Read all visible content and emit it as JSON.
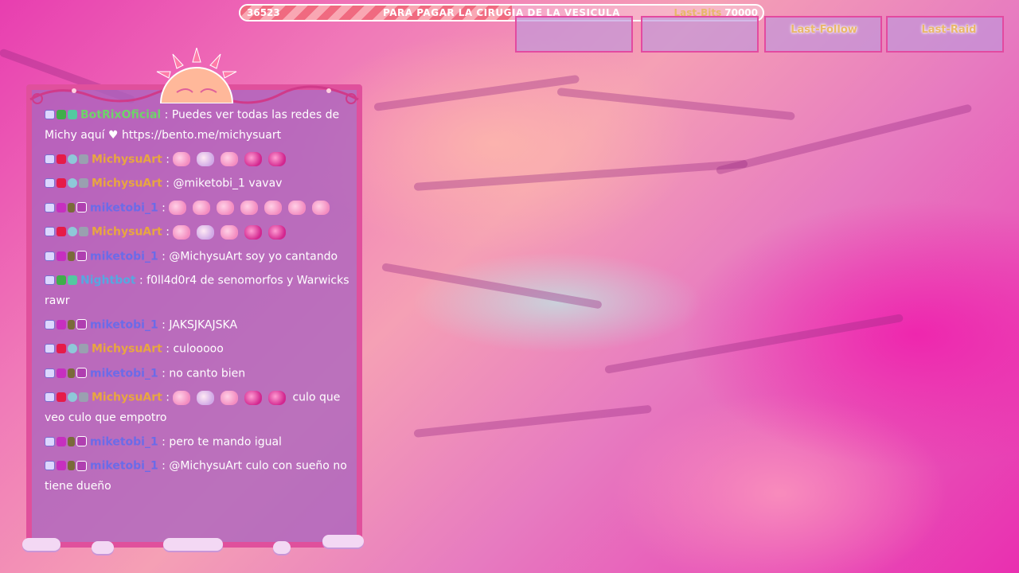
{
  "goal": {
    "current": "36523",
    "title": "PARA PAGAR LA CIRUGIA DE LA VESICULA",
    "target_label": "Last-Bits",
    "target_value": "70000",
    "progress": 0.52
  },
  "stats": [
    {
      "label": ""
    },
    {
      "label": ""
    },
    {
      "label": "Last-Follow"
    },
    {
      "label": "Last-Raid"
    }
  ],
  "chat": [
    {
      "user": "BotRixOficial",
      "color": "green",
      "badges": [
        "chat",
        "mod",
        "bot"
      ],
      "text": ": Puedes ver todas las redes de Michy aquí ♥ https://bento.me/michysuart",
      "emotes": 0
    },
    {
      "user": "MichysuArt",
      "color": "gold",
      "badges": [
        "chat",
        "bc",
        "vip",
        "robot"
      ],
      "text": ":",
      "emotes": 5
    },
    {
      "user": "MichysuArt",
      "color": "gold",
      "badges": [
        "chat",
        "bc",
        "vip",
        "robot"
      ],
      "text": ": @miketobi_1 vavav",
      "emotes": 0
    },
    {
      "user": "miketobi_1",
      "color": "blue",
      "badges": [
        "chat",
        "sub",
        "gift",
        "star"
      ],
      "text": ":",
      "emotes": 7
    },
    {
      "user": "MichysuArt",
      "color": "gold",
      "badges": [
        "chat",
        "bc",
        "vip",
        "robot"
      ],
      "text": ":",
      "emotes": 5
    },
    {
      "user": "miketobi_1",
      "color": "blue",
      "badges": [
        "chat",
        "sub",
        "gift",
        "star"
      ],
      "text": ": @MichysuArt soy yo cantando",
      "emotes": 0
    },
    {
      "user": "Nightbot",
      "color": "teal",
      "badges": [
        "chat",
        "mod",
        "bot"
      ],
      "text": ": f0ll4d0r4 de senomorfos y Warwicks rawr",
      "emotes": 0
    },
    {
      "user": "miketobi_1",
      "color": "blue",
      "badges": [
        "chat",
        "sub",
        "gift",
        "star"
      ],
      "text": ": JAKSJKAJSKA",
      "emotes": 0
    },
    {
      "user": "MichysuArt",
      "color": "gold",
      "badges": [
        "chat",
        "bc",
        "vip",
        "robot"
      ],
      "text": ": culooooo",
      "emotes": 0
    },
    {
      "user": "miketobi_1",
      "color": "blue",
      "badges": [
        "chat",
        "sub",
        "gift",
        "star"
      ],
      "text": ": no canto bien",
      "emotes": 0
    },
    {
      "user": "MichysuArt",
      "color": "gold",
      "badges": [
        "chat",
        "bc",
        "vip",
        "robot"
      ],
      "text": ":",
      "emotes": 5,
      "after": "culo que veo culo que empotro"
    },
    {
      "user": "miketobi_1",
      "color": "blue",
      "badges": [
        "chat",
        "sub",
        "gift",
        "star"
      ],
      "text": ": pero te mando igual",
      "emotes": 0
    },
    {
      "user": "miketobi_1",
      "color": "blue",
      "badges": [
        "chat",
        "sub",
        "gift",
        "star"
      ],
      "text": ": @MichysuArt culo con sueño no tiene dueño",
      "emotes": 0
    }
  ]
}
